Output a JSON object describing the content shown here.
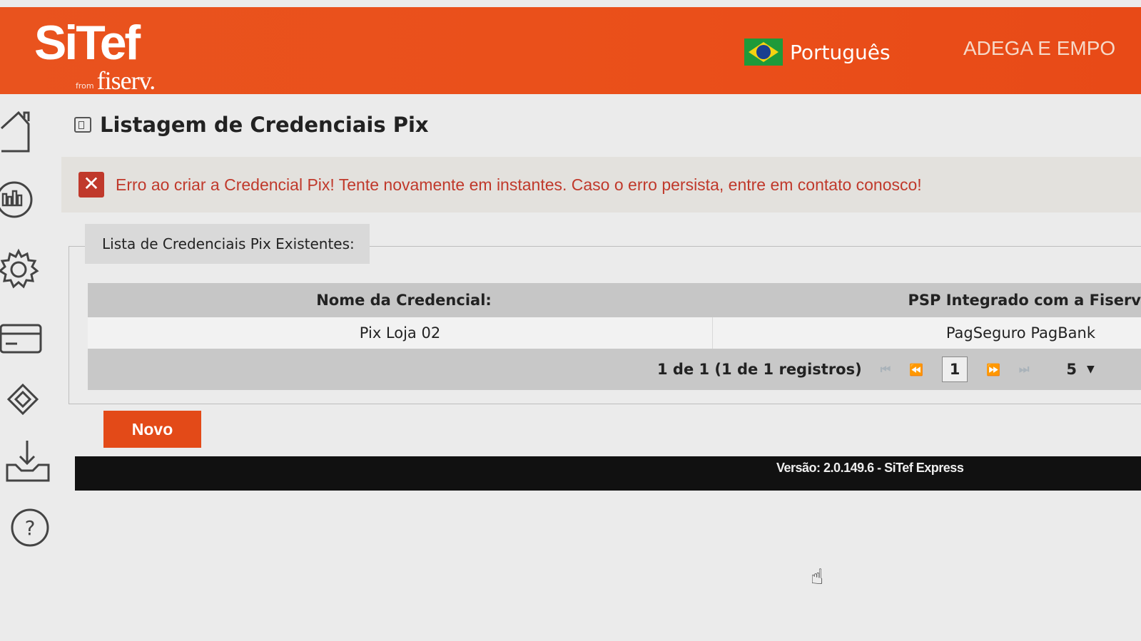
{
  "header": {
    "logo_main": "SiTef",
    "logo_from": "from",
    "logo_brand": "fiserv.",
    "language": "Português",
    "company": "ADEGA E EMPO"
  },
  "sidebar": {
    "items": [
      {
        "icon": "home-icon"
      },
      {
        "icon": "chart-icon"
      },
      {
        "icon": "gear-icon"
      },
      {
        "icon": "card-icon"
      },
      {
        "icon": "pix-icon"
      },
      {
        "icon": "download-icon"
      },
      {
        "icon": "help-icon"
      }
    ]
  },
  "page": {
    "title": "Listagem de Credenciais Pix"
  },
  "error": {
    "message": "Erro ao criar a Credencial Pix! Tente novamente em instantes. Caso o erro persista, entre em contato conosco!"
  },
  "list": {
    "legend": "Lista de Credenciais Pix Existentes:",
    "columns": [
      "Nome da Credencial:",
      "PSP Integrado com a Fiserv"
    ],
    "rows": [
      {
        "name": "Pix Loja 02",
        "psp": "PagSeguro PagBank"
      }
    ],
    "pager": {
      "info": "1 de 1 (1 de 1 registros)",
      "current_page": "1",
      "page_size": "5"
    }
  },
  "actions": {
    "new_label": "Novo"
  },
  "footer": {
    "version": "Versão: 2.0.149.6 - SiTef Express"
  },
  "colors": {
    "brand_orange": "#e9531e",
    "error_red": "#c0392b"
  }
}
